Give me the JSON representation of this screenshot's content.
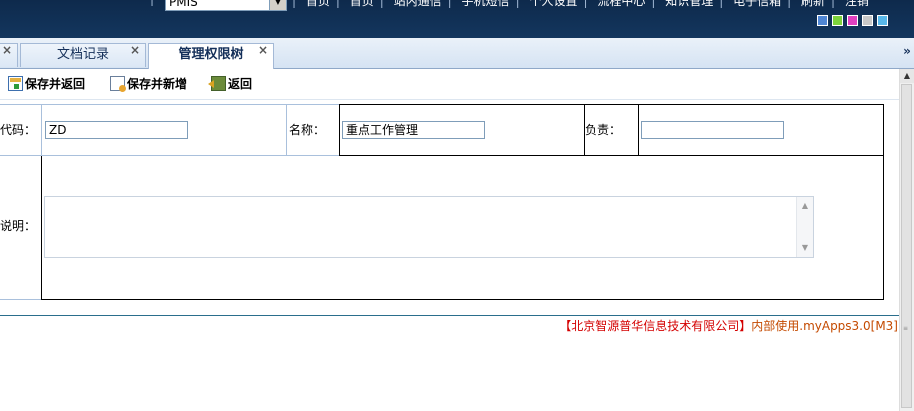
{
  "header": {
    "system_select_value": "PMIS",
    "nav": [
      "首页",
      "首页",
      "站内通信",
      "手机短信",
      "个人设置",
      "流程中心",
      "知识管理",
      "电子信箱",
      "刷新",
      "注销"
    ],
    "swatch_colors": [
      "#4f86d4",
      "#7dd33b",
      "#e040c0",
      "#c8c8c8",
      "#58b8ea"
    ]
  },
  "tabs": [
    {
      "label": "文档记录",
      "close": "×"
    },
    {
      "label": "管理权限树",
      "close": "×"
    }
  ],
  "first_tab_close": "×",
  "scroll_more": "»",
  "toolbar": {
    "save_return": "保存并返回",
    "save_new": "保存并新增",
    "back": "返回"
  },
  "form": {
    "code_label": "代码：",
    "code_value": "ZD",
    "name_label": "名称：",
    "name_value": "重点工作管理",
    "owner_label": "负责：",
    "owner_value": "",
    "desc_label": "说明："
  },
  "footer": {
    "company": "【北京智源普华信息技术有限公司】",
    "usage": "内部使用.myApps3.0[M3]"
  }
}
